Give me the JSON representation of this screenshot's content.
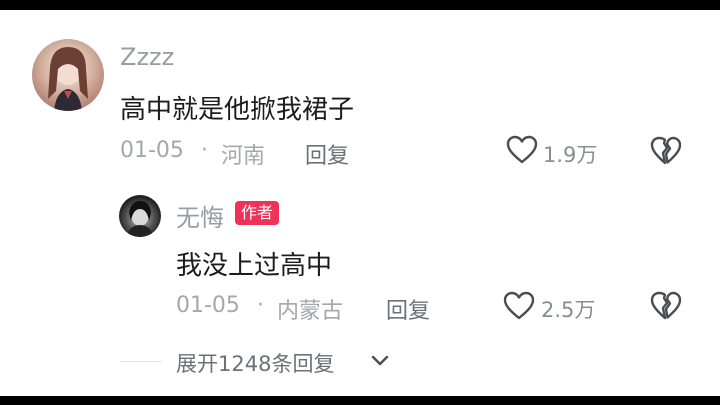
{
  "comment": {
    "username": "Zzzz",
    "text": "高中就是他掀我裙子",
    "date": "01-05",
    "separator": "·",
    "location": "河南",
    "reply_label": "回复",
    "like_count": "1.9万"
  },
  "reply": {
    "username": "无悔",
    "author_badge": "作者",
    "text": "我没上过高中",
    "date": "01-05",
    "separator": "·",
    "location": "内蒙古",
    "reply_label": "回复",
    "like_count": "2.5万"
  },
  "expand_replies_label": "展开1248条回复",
  "colors": {
    "badge": "#f0315a",
    "username": "#9a9ca3",
    "text": "#1c1c1e",
    "meta": "#a5a7ad"
  },
  "icons": [
    "heart-outline-icon",
    "broken-heart-icon",
    "chevron-down-icon"
  ]
}
